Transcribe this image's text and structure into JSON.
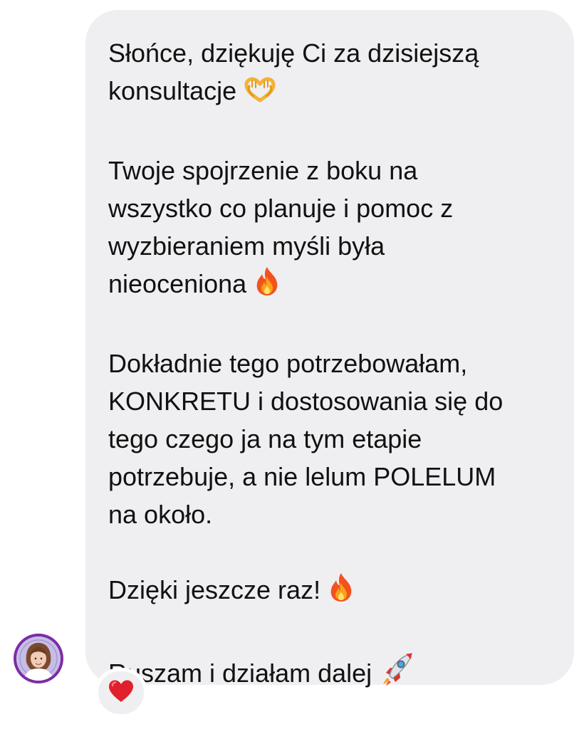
{
  "message": {
    "paragraphs": [
      {
        "lines": [
          "Słońce, dziękuję Ci za dzisiejszą",
          "konsultacje"
        ],
        "trailing_emoji": "heart-hands"
      },
      {
        "lines": [
          "Twoje spojrzenie z boku na",
          "wszystko co planuje i pomoc z",
          "wyzbieraniem myśli była",
          "nieoceniona"
        ],
        "trailing_emoji": "fire"
      },
      {
        "lines": [
          "Dokładnie tego potrzebowałam,",
          "KONKRETU i dostosowania się do",
          "tego czego ja na tym etapie",
          "potrzebuje, a nie lelum POLELUM",
          "na około."
        ],
        "trailing_emoji": ""
      },
      {
        "lines": [
          "Dzięki jeszcze raz!"
        ],
        "trailing_emoji": "fire"
      },
      {
        "lines": [
          "Ruszam i działam dalej"
        ],
        "trailing_emoji": "rocket"
      }
    ]
  },
  "sender": {
    "avatar_icon": "user-avatar"
  },
  "reaction": {
    "emoji": "red-heart"
  },
  "colors": {
    "bubble_background": "#efeff1",
    "text": "#111111",
    "avatar_ring": "#7c2ca6",
    "reaction_heart": "#e0202c"
  }
}
